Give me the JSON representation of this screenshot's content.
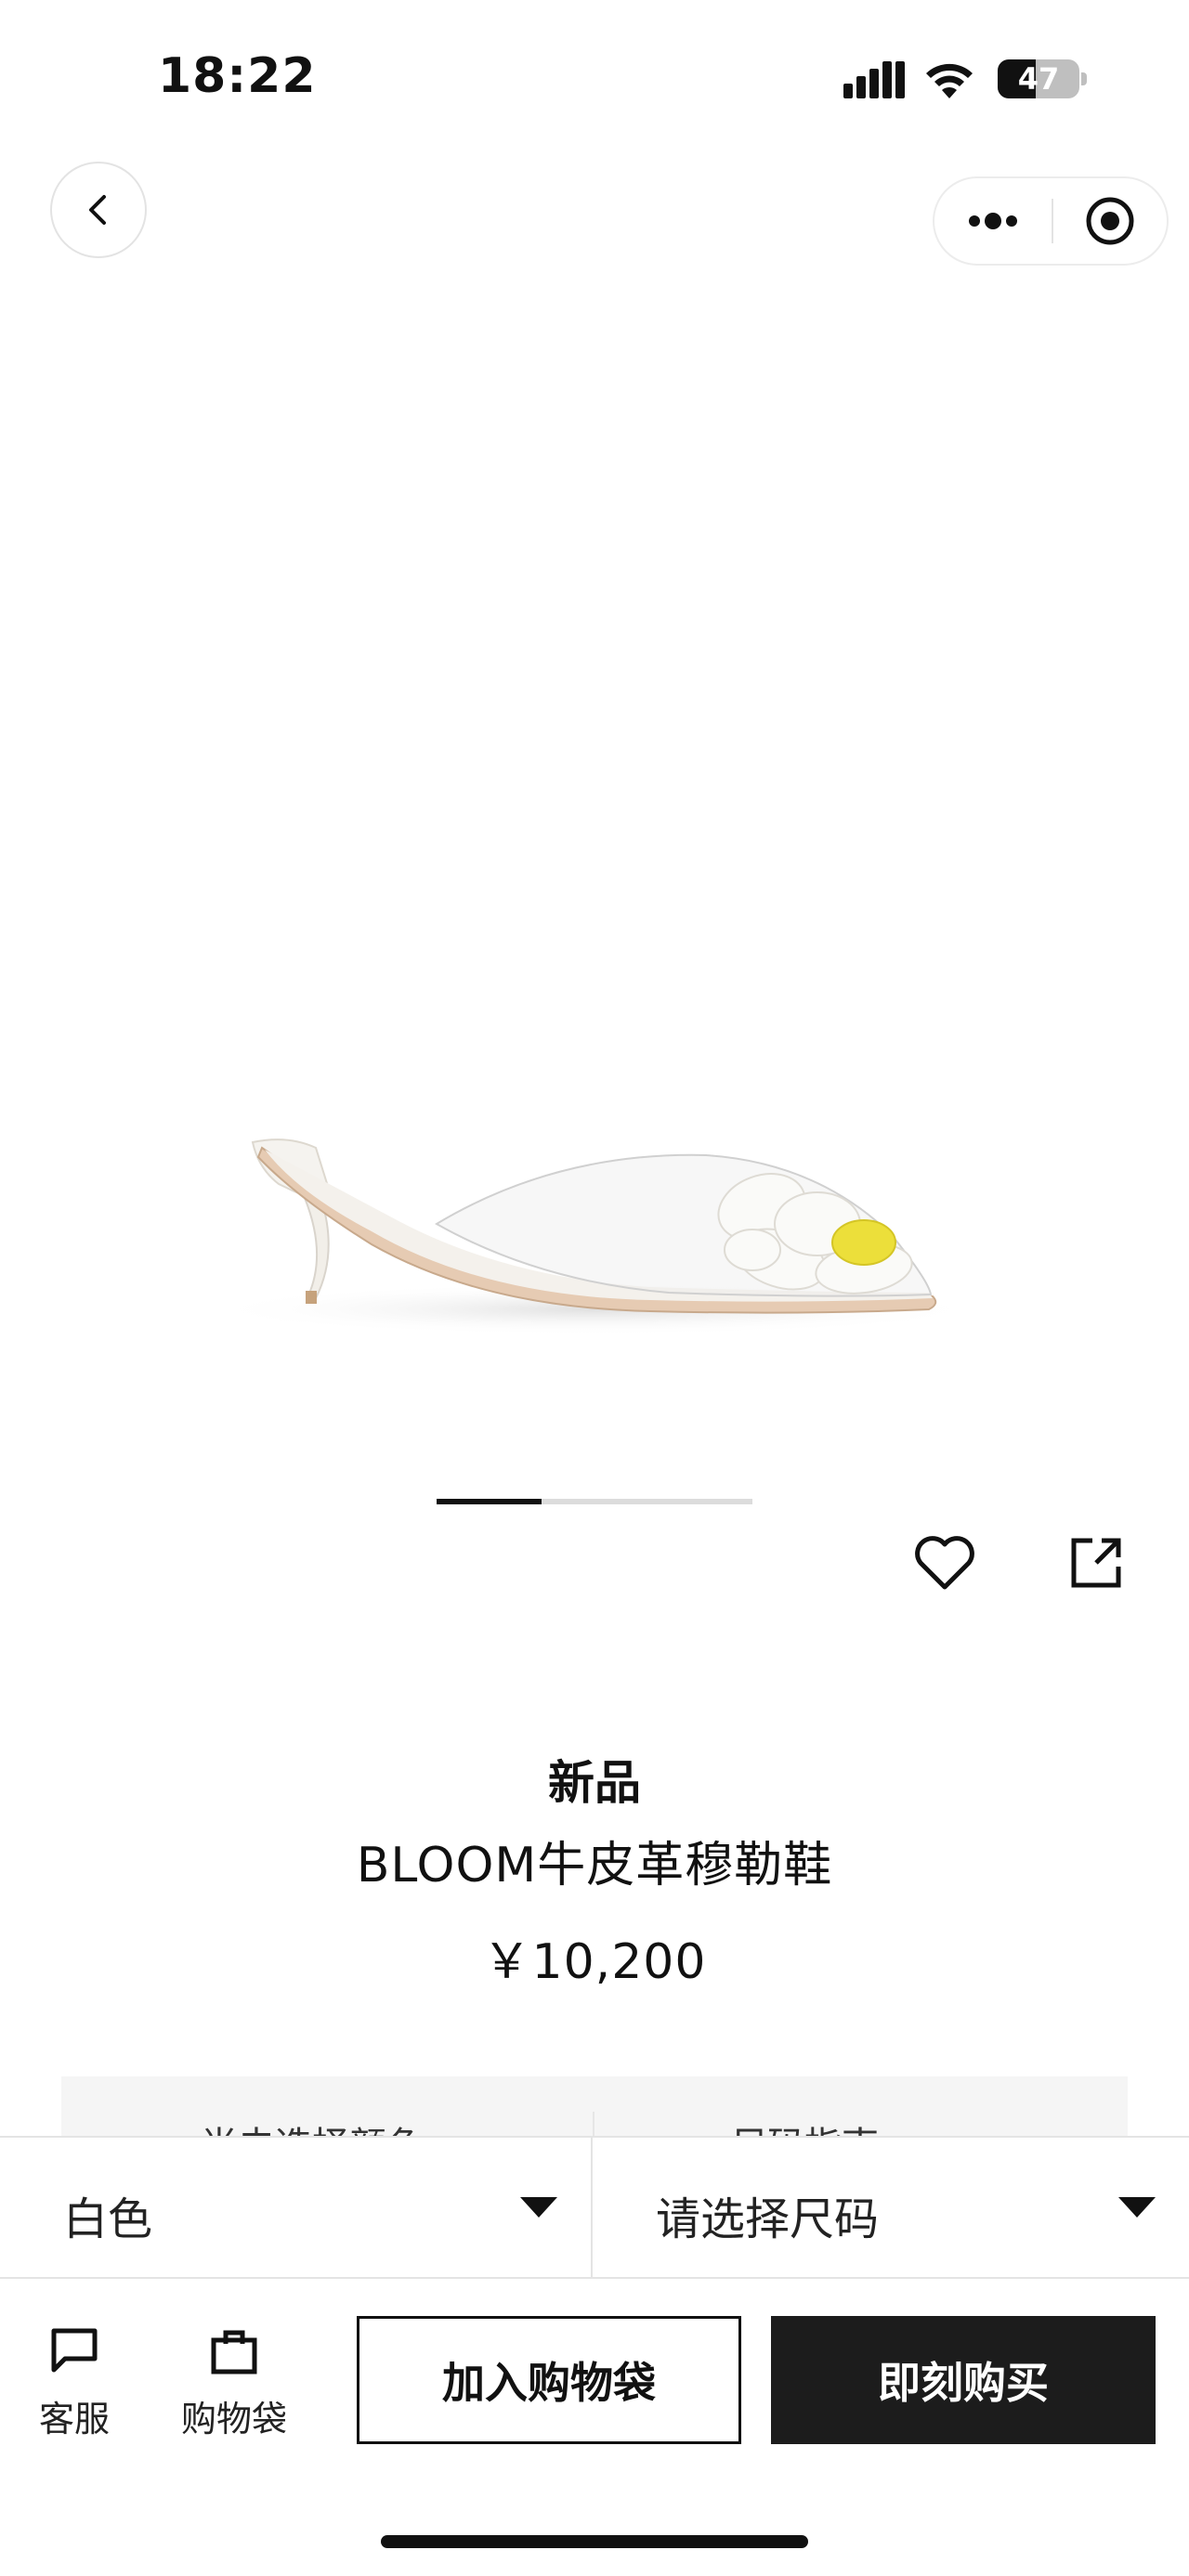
{
  "status_bar": {
    "time": "18:22",
    "battery_level": "47",
    "battery_fraction": 0.47
  },
  "nav": {
    "back_icon": "chevron-left-icon",
    "more_icon": "more-dots-icon",
    "target_icon": "record-target-icon"
  },
  "gallery": {
    "page_count": 3,
    "current_index": 0,
    "product_image": "white-kitten-heel-mule-with-flower"
  },
  "actions": {
    "favorite_icon": "heart-icon",
    "share_icon": "share-icon"
  },
  "product": {
    "badge": "新品",
    "name": "BLOOM牛皮革穆勒鞋",
    "price": "￥10,200"
  },
  "peek_row": {
    "left_label": "尚未选择颜色",
    "right_label": "尺码指南"
  },
  "selectors": {
    "color_value": "白色",
    "size_placeholder": "请选择尺码"
  },
  "bottom_bar": {
    "customer_service_label": "客服",
    "bag_label": "购物袋",
    "add_to_bag_label": "加入购物袋",
    "buy_now_label": "即刻购买"
  },
  "colors": {
    "primary_dark": "#1c1c1c",
    "background": "#ffffff",
    "border": "#e4e4e4"
  }
}
